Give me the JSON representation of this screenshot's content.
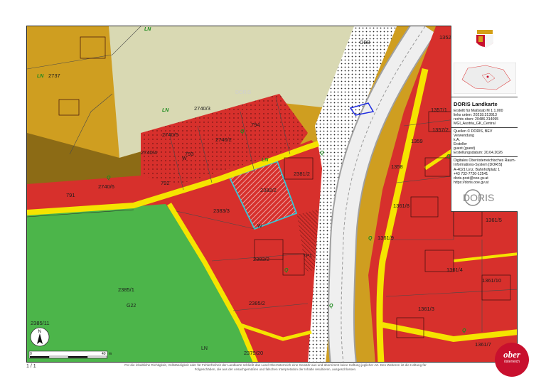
{
  "panel": {
    "title": "DORIS Landkarte",
    "scale_line": "Erstellt für Maßstab M 1:1.000",
    "coords_bottom_left": "links unten: 20218.313913",
    "coords_top_right": "rechts oben: 20486.314095",
    "crs": "MGI_Austria_GK_Central",
    "sources": "Quellen © DORIS, BEV",
    "usage_label": "Verwendung",
    "usage_value": "k.A.",
    "author_label": "Ersteller",
    "author_value": "guest (guest)",
    "created": "Erstellungsdatum: 20.04.2026",
    "org_name": "Digitales Oberösterreichisches Raum-Informations-System [DORIS]",
    "address": "A-4021 Linz, Bahnhofplatz 1",
    "phone": "+43 732-7720-12541",
    "email": "doris.post@ooe.gv.at",
    "web": "https://doris.ooe.gv.at",
    "logo_text": "DORIS"
  },
  "brand_logo": {
    "line1": "ober",
    "line2": "österreich"
  },
  "page_number": "1 / 1",
  "disclaimer": "Für die inhaltliche Richtigkeit, Vollständigkeit oder für Fehlerfreiheit der Landkarte schließt das Land Oberösterreich eine Gewähr aus und übernimmt keine Haftung jeglicher Art. Des Weiteren ist die Haftung für Folgeschäden, die aus der unsachgemäßen und falschen Interpretation der Inhalte resultieren, ausgeschlossen.",
  "north_label": "N",
  "scale_bar": {
    "start": "0",
    "mid": "40",
    "unit": "m"
  },
  "map": {
    "plot_labels": [
      "2737",
      "2740/3",
      "2740/5",
      "2740/4",
      "2740/2",
      "2740/6",
      "794",
      "793",
      "792",
      "791",
      "2381/2",
      "2382/2",
      "2383/3",
      "2383/2",
      "2385/1",
      "2385/2",
      "2385/11",
      "2379/20",
      "1352",
      "1357/1",
      "1357/2",
      "1359",
      "1358",
      "1361/9",
      "1361/8",
      "1361/5",
      "1361/4",
      "1361/10",
      "1361/3",
      "1361/7"
    ],
    "zone_labels": [
      "LN",
      "LN",
      "LN",
      "LN",
      "Q",
      "Q",
      "Q",
      "Q",
      "Q",
      "Q",
      "Q",
      "Q"
    ],
    "misc_labels": {
      "rail": "ÖBB",
      "watermark": "DORIS",
      "field_code": "G22",
      "w1": "W",
      "w2": "W",
      "ln_right": "LN",
      "tp": "TP1"
    },
    "colors": {
      "building_land": "#d7302c",
      "mixed": "#b8860b",
      "grassland": "#d8d8b0",
      "field": "#4cb54a",
      "road": "#f5e400",
      "rail": "#ffffff",
      "highlight": "#33c8d8"
    }
  }
}
